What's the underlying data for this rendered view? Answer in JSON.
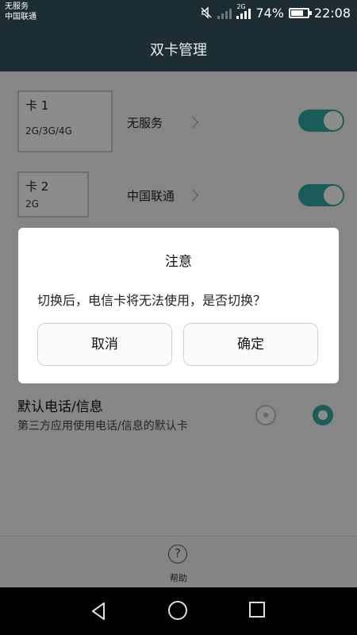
{
  "status_bar": {
    "carrier_1": "无服务",
    "carrier_2": "中国联通",
    "network_type": "2G",
    "battery_percent": "74%",
    "battery_level": 0.74,
    "time": "22:08",
    "icons": [
      "mute-icon",
      "signal-icon",
      "battery-icon"
    ]
  },
  "header": {
    "title": "双卡管理"
  },
  "cards": [
    {
      "name": "卡 1",
      "networks": "2G/3G/4G",
      "status": "无服务",
      "enabled": true
    },
    {
      "name": "卡 2",
      "networks": "2G",
      "status": "中国联通",
      "enabled": true
    }
  ],
  "default_setting": {
    "title": "默认电话/信息",
    "description": "第三方应用使用电话/信息的默认卡",
    "selected_index": 1
  },
  "help": {
    "label": "帮助",
    "icon": "help-icon"
  },
  "dialog": {
    "title": "注意",
    "message": "切换后，电信卡将无法使用，是否切换？",
    "cancel_label": "取消",
    "confirm_label": "确定"
  },
  "colors": {
    "accent": "#2fa8a1",
    "header_bg": "#1d2d34",
    "overlay": "rgba(0,0,0,0.45)"
  },
  "nav_bar": {
    "icons": [
      "back-icon",
      "home-icon",
      "recent-apps-icon"
    ]
  }
}
